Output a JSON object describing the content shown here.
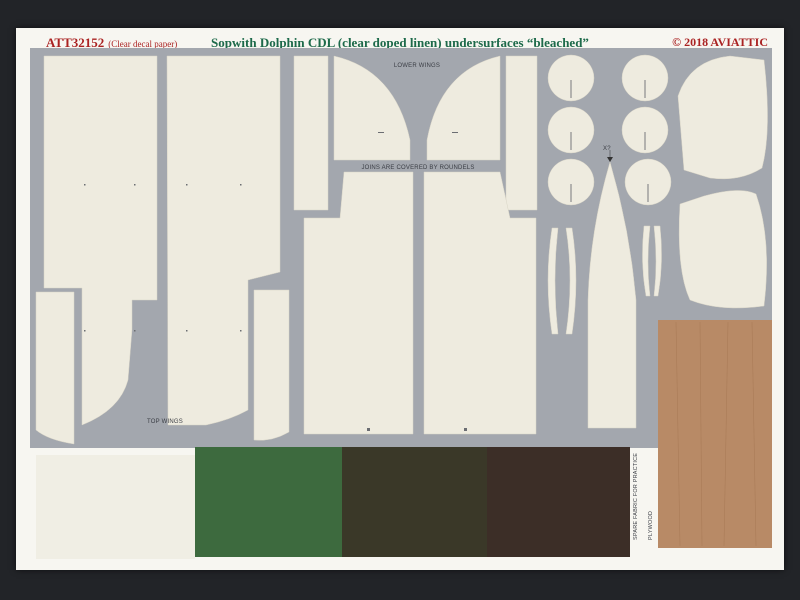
{
  "sheet": {
    "code": "ATT32152",
    "note": "(Clear decal paper)",
    "title": "Sopwith Dolphin CDL (clear doped linen) undersurfaces “bleached”",
    "copyright": "© 2018 AVIATTIC"
  },
  "labels": {
    "lower_wings": "LOWER WINGS",
    "top_wings": "TOP WINGS",
    "joins": "JOINS ARE COVERED BY ROUNDELS",
    "spare_fabric": "SPARE FABRIC FOR PRACTICE",
    "plywood": "PLYWOOD",
    "marker": "X?"
  },
  "colors": {
    "paper": "#f7f6f1",
    "grey_field": "#a3a7ae",
    "linen_decal": "#eeebdf",
    "swatch_green": "#3d6a3e",
    "swatch_olive": "#3a3828",
    "swatch_brown": "#3c2e27",
    "plywood": "#b88a66",
    "title_green": "#1d6a4a",
    "title_red": "#a22"
  }
}
